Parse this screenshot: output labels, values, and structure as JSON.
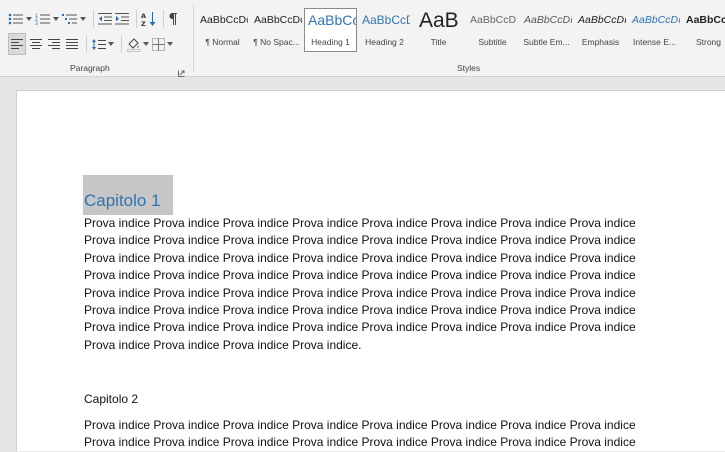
{
  "ribbon": {
    "paragraph_group_label": "Paragraph",
    "styles_group_label": "Styles",
    "paragraph_buttons": [
      "bullets-icon",
      "numbering-icon",
      "multilevel-list-icon",
      "decrease-indent-icon",
      "increase-indent-icon",
      "sort-icon",
      "show-formatting-marks-icon",
      "align-left-icon",
      "align-center-icon",
      "align-right-icon",
      "justify-icon",
      "line-spacing-icon",
      "shading-icon",
      "borders-icon"
    ],
    "styles": [
      {
        "preview": "AaBbCcDc",
        "label": "¶ Normal"
      },
      {
        "preview": "AaBbCcDc",
        "label": "¶ No Spac..."
      },
      {
        "preview": "AaBbCc",
        "label": "Heading 1"
      },
      {
        "preview": "AaBbCcD",
        "label": "Heading 2"
      },
      {
        "preview": "AaB",
        "label": "Title"
      },
      {
        "preview": "AaBbCcD",
        "label": "Subtitle"
      },
      {
        "preview": "AaBbCcDı",
        "label": "Subtle Em..."
      },
      {
        "preview": "AaBbCcDı",
        "label": "Emphasis"
      },
      {
        "preview": "AaBbCcDı",
        "label": "Intense E..."
      },
      {
        "preview": "AaBbCcDc",
        "label": "Strong"
      }
    ],
    "selected_style": "Heading 1"
  },
  "document": {
    "heading1": "Capitolo 1",
    "para1_lines": [
      "Prova indice Prova indice Prova indice Prova indice Prova indice Prova indice  Prova indice Prova indice",
      "Prova indice Prova indice Prova indice Prova indice Prova indice Prova indice Prova indice Prova indice",
      "Prova indice Prova indice  Prova indice Prova indice Prova indice Prova indice Prova indice Prova indice",
      "Prova indice Prova indice Prova indice Prova indice Prova indice Prova indice  Prova indice Prova indice",
      "Prova indice Prova indice Prova indice Prova indice Prova indice Prova indice Prova indice Prova indice",
      "Prova indice Prova indice  Prova indice Prova indice Prova indice Prova indice Prova indice Prova indice",
      "Prova indice Prova indice Prova indice Prova indice Prova indice Prova indice  Prova indice Prova indice",
      "Prova indice Prova indice Prova indice Prova indice."
    ],
    "heading2": "Capitolo 2",
    "para2_lines": [
      "Prova indice Prova indice Prova indice Prova indice Prova indice Prova indice  Prova indice Prova indice",
      "Prova indice Prova indice Prova indice Prova indice Prova indice Prova indice Prova indice Prova indice"
    ]
  },
  "colors": {
    "heading1": "#2e74b5",
    "selection": "#c6c6c6",
    "ribbon": "#f3f3f3"
  }
}
